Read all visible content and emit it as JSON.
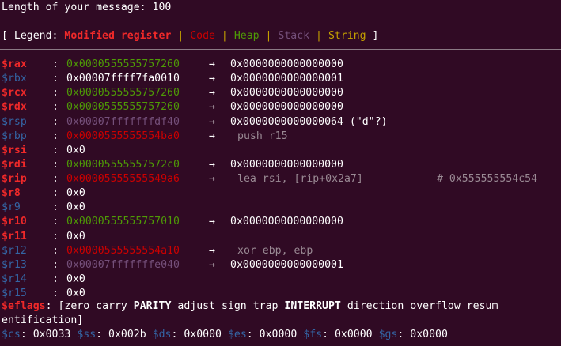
{
  "header": {
    "message_length": "Length of your message: 100"
  },
  "legend": {
    "open": "[ Legend: ",
    "modified": "Modified register",
    "sep": " | ",
    "code": "Code",
    "heap": "Heap",
    "stack": "Stack",
    "string": "String",
    "close": " ]"
  },
  "arrow": "→",
  "registers": [
    {
      "name": "$rax",
      "modified": true,
      "value": "0x0000555555757260",
      "value_kind": "heap",
      "deref": "0x0000000000000000",
      "deref_kind": "plain"
    },
    {
      "name": "$rbx",
      "modified": false,
      "value": "0x00007ffff7fa0010",
      "value_kind": "plain",
      "deref": "0x0000000000000001",
      "deref_kind": "plain"
    },
    {
      "name": "$rcx",
      "modified": true,
      "value": "0x0000555555757260",
      "value_kind": "heap",
      "deref": "0x0000000000000000",
      "deref_kind": "plain"
    },
    {
      "name": "$rdx",
      "modified": true,
      "value": "0x0000555555757260",
      "value_kind": "heap",
      "deref": "0x0000000000000000",
      "deref_kind": "plain"
    },
    {
      "name": "$rsp",
      "modified": false,
      "value": "0x00007fffffffdf40",
      "value_kind": "stack",
      "deref": "0x0000000000000064 (\"d\"?)",
      "deref_kind": "plain"
    },
    {
      "name": "$rbp",
      "modified": false,
      "value": "0x0000555555554ba0",
      "value_kind": "code",
      "deref": "push r15",
      "deref_kind": "instr"
    },
    {
      "name": "$rsi",
      "modified": true,
      "value": "0x0",
      "value_kind": "plain",
      "deref": "",
      "deref_kind": "plain"
    },
    {
      "name": "$rdi",
      "modified": true,
      "value": "0x00005555557572c0",
      "value_kind": "heap",
      "deref": "0x0000000000000000",
      "deref_kind": "plain"
    },
    {
      "name": "$rip",
      "modified": true,
      "value": "0x00005555555549a6",
      "value_kind": "code",
      "deref": "lea rsi, [rip+0x2a7]",
      "deref_kind": "instr",
      "comment": "# 0x555555554c54"
    },
    {
      "name": "$r8",
      "modified": true,
      "value": "0x0",
      "value_kind": "plain",
      "deref": "",
      "deref_kind": "plain"
    },
    {
      "name": "$r9",
      "modified": false,
      "value": "0x0",
      "value_kind": "plain",
      "deref": "",
      "deref_kind": "plain"
    },
    {
      "name": "$r10",
      "modified": true,
      "value": "0x0000555555757010",
      "value_kind": "heap",
      "deref": "0x0000000000000000",
      "deref_kind": "plain"
    },
    {
      "name": "$r11",
      "modified": true,
      "value": "0x0",
      "value_kind": "plain",
      "deref": "",
      "deref_kind": "plain"
    },
    {
      "name": "$r12",
      "modified": false,
      "value": "0x0000555555554a10",
      "value_kind": "code",
      "deref": "xor ebp, ebp",
      "deref_kind": "instr"
    },
    {
      "name": "$r13",
      "modified": false,
      "value": "0x00007fffffffe040",
      "value_kind": "stack",
      "deref": "0x0000000000000001",
      "deref_kind": "plain"
    },
    {
      "name": "$r14",
      "modified": false,
      "value": "0x0",
      "value_kind": "plain",
      "deref": "",
      "deref_kind": "plain"
    },
    {
      "name": "$r15",
      "modified": false,
      "value": "0x0",
      "value_kind": "plain",
      "deref": "",
      "deref_kind": "plain"
    }
  ],
  "eflags": {
    "name": "$eflags",
    "open": ": [",
    "flags": [
      {
        "text": "zero",
        "set": false
      },
      {
        "text": "carry",
        "set": false
      },
      {
        "text": "PARITY",
        "set": true
      },
      {
        "text": "adjust",
        "set": false
      },
      {
        "text": "sign",
        "set": false
      },
      {
        "text": "trap",
        "set": false
      },
      {
        "text": "INTERRUPT",
        "set": true
      },
      {
        "text": "direction",
        "set": false
      },
      {
        "text": "overflow",
        "set": false
      },
      {
        "text": "resum",
        "set": false
      }
    ],
    "continuation": "entification]"
  },
  "segments": [
    {
      "name": "$cs",
      "value": "0x0033"
    },
    {
      "name": "$ss",
      "value": "0x002b"
    },
    {
      "name": "$ds",
      "value": "0x0000"
    },
    {
      "name": "$es",
      "value": "0x0000"
    },
    {
      "name": "$fs",
      "value": "0x0000"
    },
    {
      "name": "$gs",
      "value": "0x0000"
    }
  ],
  "colors": {
    "background": "#300a24",
    "modified_register": "#ef2929",
    "register": "#3465a4",
    "code": "#cc0000",
    "heap": "#4e9a06",
    "stack": "#75507b",
    "string": "#c4a000"
  }
}
